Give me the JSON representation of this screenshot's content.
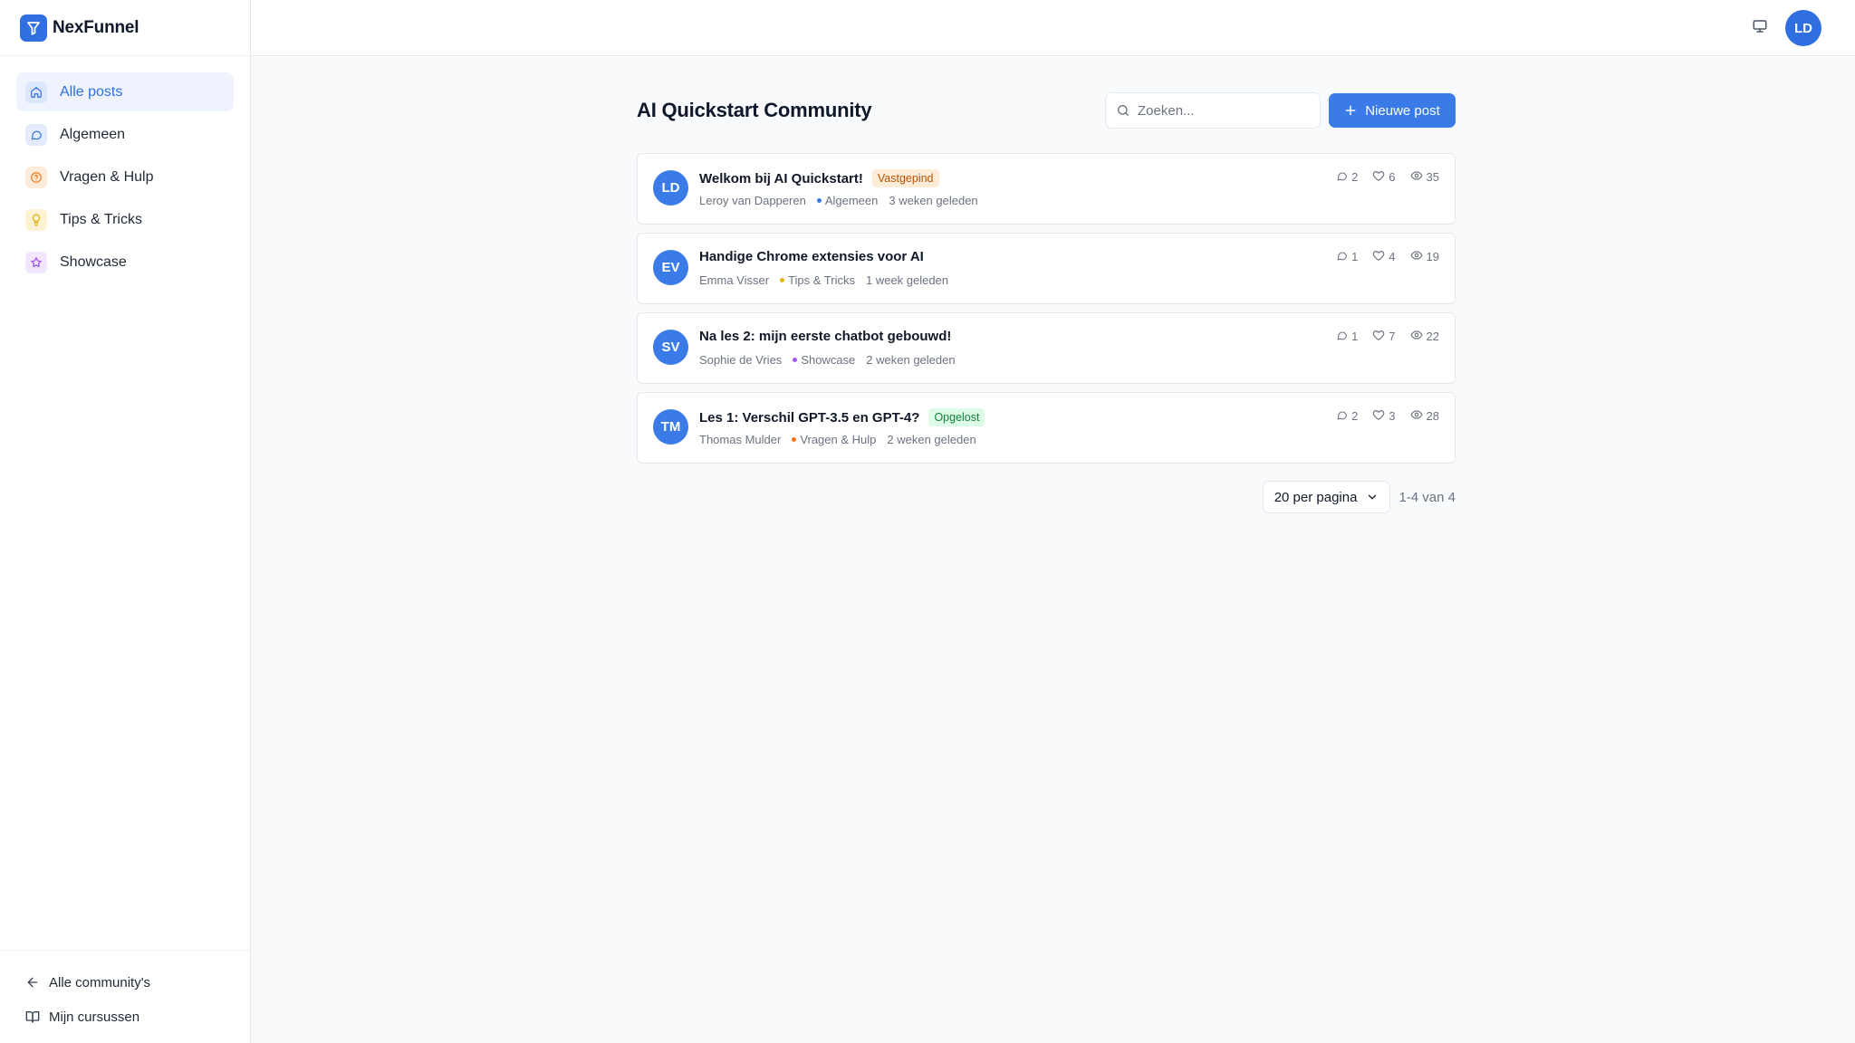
{
  "app": {
    "name": "NexFunnel"
  },
  "sidebar": {
    "items": [
      {
        "label": "Alle posts",
        "icon": "home-icon",
        "active": true,
        "color": "#2f6fe0"
      },
      {
        "label": "Algemeen",
        "icon": "message-circle-icon",
        "color": "#2f6fe0"
      },
      {
        "label": "Vragen & Hulp",
        "icon": "help-circle-icon",
        "color": "#ea7a1f"
      },
      {
        "label": "Tips & Tricks",
        "icon": "lightbulb-icon",
        "color": "#e0a800"
      },
      {
        "label": "Showcase",
        "icon": "star-icon",
        "color": "#9b4fe0"
      }
    ],
    "footer": {
      "all_communities": "Alle community's",
      "my_courses": "Mijn cursussen"
    }
  },
  "topbar": {
    "user_initials": "LD"
  },
  "main": {
    "title": "AI Quickstart Community",
    "search_placeholder": "Zoeken...",
    "new_post_label": "Nieuwe post"
  },
  "posts": [
    {
      "initials": "LD",
      "title": "Welkom bij AI Quickstart!",
      "badge": "Vastgepind",
      "badge_type": "pinned",
      "author": "Leroy van Dapperen",
      "category": "Algemeen",
      "category_color": "#3b7be8",
      "time": "3 weken geleden",
      "comments": "2",
      "likes": "6",
      "views": "35"
    },
    {
      "initials": "EV",
      "title": "Handige Chrome extensies voor AI",
      "badge": "",
      "badge_type": "",
      "author": "Emma Visser",
      "category": "Tips & Tricks",
      "category_color": "#eab308",
      "time": "1 week geleden",
      "comments": "1",
      "likes": "4",
      "views": "19"
    },
    {
      "initials": "SV",
      "title": "Na les 2: mijn eerste chatbot gebouwd!",
      "badge": "",
      "badge_type": "",
      "author": "Sophie de Vries",
      "category": "Showcase",
      "category_color": "#a855f7",
      "time": "2 weken geleden",
      "comments": "1",
      "likes": "7",
      "views": "22"
    },
    {
      "initials": "TM",
      "title": "Les 1: Verschil GPT-3.5 en GPT-4?",
      "badge": "Opgelost",
      "badge_type": "solved",
      "author": "Thomas Mulder",
      "category": "Vragen & Hulp",
      "category_color": "#f97316",
      "time": "2 weken geleden",
      "comments": "2",
      "likes": "3",
      "views": "28"
    }
  ],
  "pagination": {
    "per_page_label": "20 per pagina",
    "range": "1-4 van 4"
  }
}
